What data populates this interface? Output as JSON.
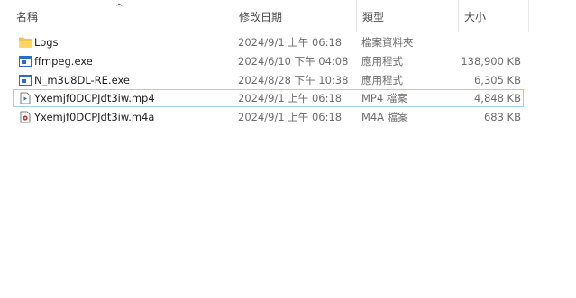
{
  "columns": {
    "name": "名稱",
    "date": "修改日期",
    "type": "類型",
    "size": "大小"
  },
  "files": [
    {
      "name": "Logs",
      "date": "2024/9/1 上午 06:18",
      "type": "檔案資料夾",
      "size": "",
      "icon": "folder-icon"
    },
    {
      "name": "ffmpeg.exe",
      "date": "2024/6/10 下午 04:08",
      "type": "應用程式",
      "size": "138,900 KB",
      "icon": "application-icon"
    },
    {
      "name": "N_m3u8DL-RE.exe",
      "date": "2024/8/28 下午 10:38",
      "type": "應用程式",
      "size": "6,305 KB",
      "icon": "application-icon"
    },
    {
      "name": "Yxemjf0DCPJdt3iw.mp4",
      "date": "2024/9/1 上午 06:18",
      "type": "MP4 檔案",
      "size": "4,848 KB",
      "icon": "video-file-icon"
    },
    {
      "name": "Yxemjf0DCPJdt3iw.m4a",
      "date": "2024/9/1 上午 06:18",
      "type": "M4A 檔案",
      "size": "683 KB",
      "icon": "audio-file-icon"
    }
  ],
  "colors": {
    "folder": "#f4c542",
    "app_blue": "#2b6cc4",
    "selection_border": "#99d1ff"
  }
}
